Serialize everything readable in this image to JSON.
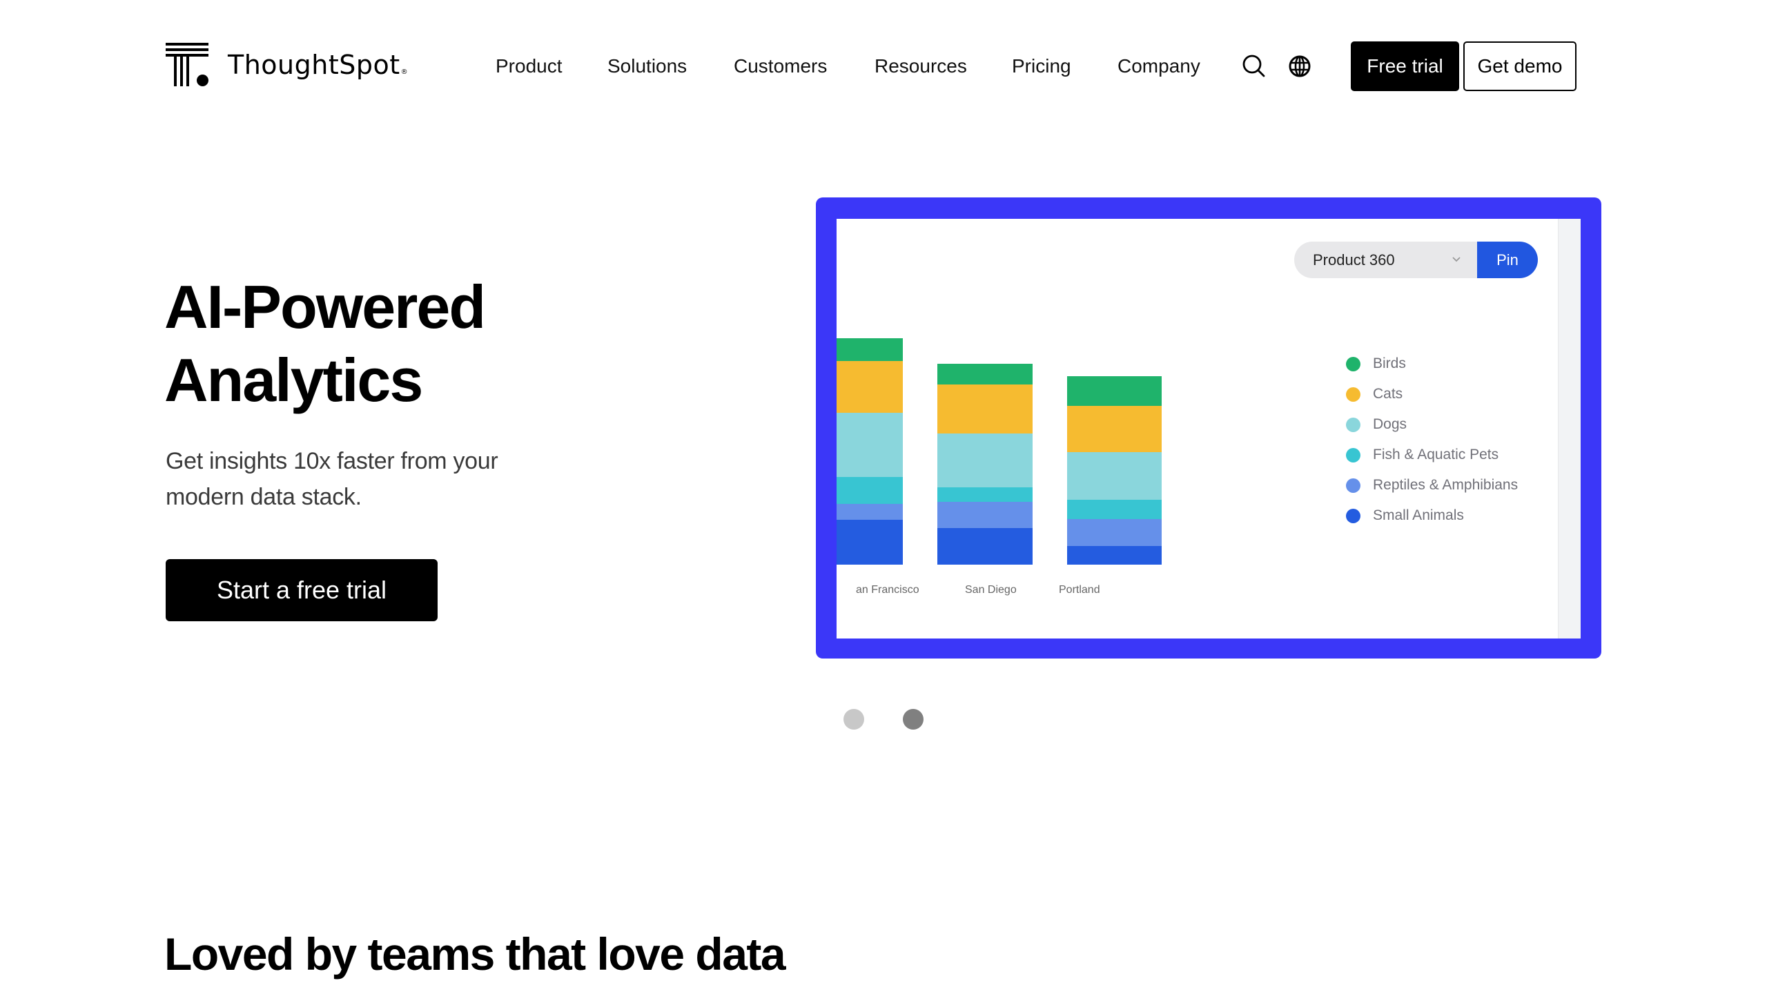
{
  "brand": {
    "name": "ThoughtSpot",
    "trademark": "®",
    "logo_icon": "thoughtspot-t-mark-icon"
  },
  "nav": {
    "items": [
      {
        "label": "Product"
      },
      {
        "label": "Solutions"
      },
      {
        "label": "Customers"
      },
      {
        "label": "Resources"
      },
      {
        "label": "Pricing"
      },
      {
        "label": "Company"
      }
    ],
    "search_icon": "search-icon",
    "language_icon": "globe-icon",
    "free_trial_label": "Free trial",
    "get_demo_label": "Get demo"
  },
  "hero": {
    "title_line1": "AI-Powered",
    "title_line2": "Analytics",
    "subtitle": "Get insights 10x faster from your modern data stack.",
    "cta_label": "Start a free trial"
  },
  "card": {
    "border_color": "#3b37f8",
    "dropdown_value": "Product 360",
    "pin_label": "Pin",
    "pin_color": "#2157e0"
  },
  "chart_data": {
    "type": "bar",
    "stacked": true,
    "title": "",
    "xlabel": "",
    "ylabel": "",
    "categories": [
      "San Francisco",
      "San Diego",
      "Portland"
    ],
    "category_labels_visible": [
      "an Francisco",
      "San Diego",
      "Portland"
    ],
    "series": [
      {
        "name": "Birds",
        "color": "#1fb36b",
        "values": [
          33,
          30,
          43
        ]
      },
      {
        "name": "Cats",
        "color": "#f6bb30",
        "values": [
          75,
          71,
          67
        ]
      },
      {
        "name": "Dogs",
        "color": "#8ad6dc",
        "values": [
          93,
          78,
          69
        ]
      },
      {
        "name": "Fish & Aquatic Pets",
        "color": "#38c5d2",
        "values": [
          39,
          21,
          28
        ]
      },
      {
        "name": "Reptiles & Amphibians",
        "color": "#6590ea",
        "values": [
          23,
          38,
          39
        ]
      },
      {
        "name": "Small Animals",
        "color": "#245ce0",
        "values": [
          65,
          53,
          27
        ]
      }
    ],
    "ylim": [
      0,
      400
    ],
    "grid": false,
    "legend_position": "right"
  },
  "carousel": {
    "slides": [
      {
        "active": false,
        "color": "#c8c8c8"
      },
      {
        "active": true,
        "color": "#808080"
      }
    ]
  },
  "section": {
    "title": "Loved by teams that love data"
  }
}
